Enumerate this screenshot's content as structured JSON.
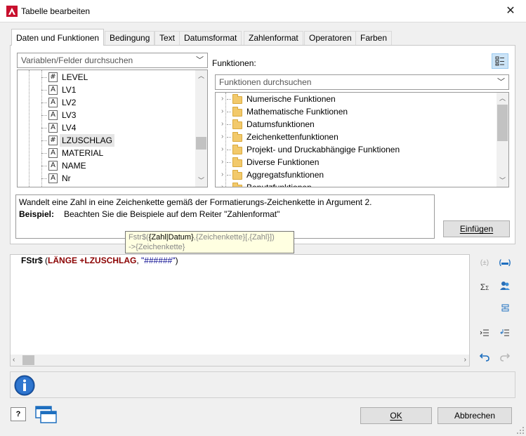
{
  "window": {
    "title": "Tabelle bearbeiten",
    "close": "✕"
  },
  "tabs": [
    "Daten und Funktionen",
    "Bedingung",
    "Text",
    "Datumsformat",
    "Zahlenformat",
    "Operatoren",
    "Farben"
  ],
  "variables": {
    "search_placeholder": "Variablen/Felder durchsuchen",
    "items": [
      {
        "label": "LEVEL",
        "type": "#"
      },
      {
        "label": "LV1",
        "type": "A"
      },
      {
        "label": "LV2",
        "type": "A"
      },
      {
        "label": "LV3",
        "type": "A"
      },
      {
        "label": "LV4",
        "type": "A"
      },
      {
        "label": "LZUSCHLAG",
        "type": "#"
      },
      {
        "label": "MATERIAL",
        "type": "A"
      },
      {
        "label": "NAME",
        "type": "A"
      },
      {
        "label": "Nr",
        "type": "A"
      }
    ],
    "selected": "LZUSCHLAG"
  },
  "functions": {
    "label": "Funktionen:",
    "search_placeholder": "Funktionen durchsuchen",
    "categories": [
      "Numerische Funktionen",
      "Mathematische Funktionen",
      "Datumsfunktionen",
      "Zeichenkettenfunktionen",
      "Projekt- und Druckabhängige Funktionen",
      "Diverse Funktionen",
      "Aggregatsfunktionen",
      "Benutzfunktionen"
    ]
  },
  "description": {
    "line1": "Wandelt eine Zahl in eine Zeichenkette gemäß der Formatierungs-Zeichenkette in Argument 2.",
    "example_label": "Beispiel:",
    "example_text": "Beachten Sie die Beispiele auf dem Reiter \"Zahlenformat\""
  },
  "insert_button": "Einfügen",
  "tooltip": {
    "fn": "Fstr$(",
    "arg1": "{Zahl|Datum}",
    "sep1": ",",
    "arg2": "{Zeichenkette}",
    "arg3": "[,{Zahl}]",
    "close": ")",
    "return": "->{Zeichenkette}"
  },
  "editor": {
    "fn": "FStr$",
    "open": " (",
    "arg1": "LÄNGE +LZUSCHLAG",
    "sep": ", ",
    "arg2": "\"######\"",
    "close": ")"
  },
  "buttons": {
    "ok": "OK",
    "cancel": "Abbrechen"
  },
  "colors": {
    "accent": "#0078d7",
    "fn_keyword": "#8b0000",
    "tooltip_bg": "#ffffe1",
    "folder": "#f2c96b"
  }
}
